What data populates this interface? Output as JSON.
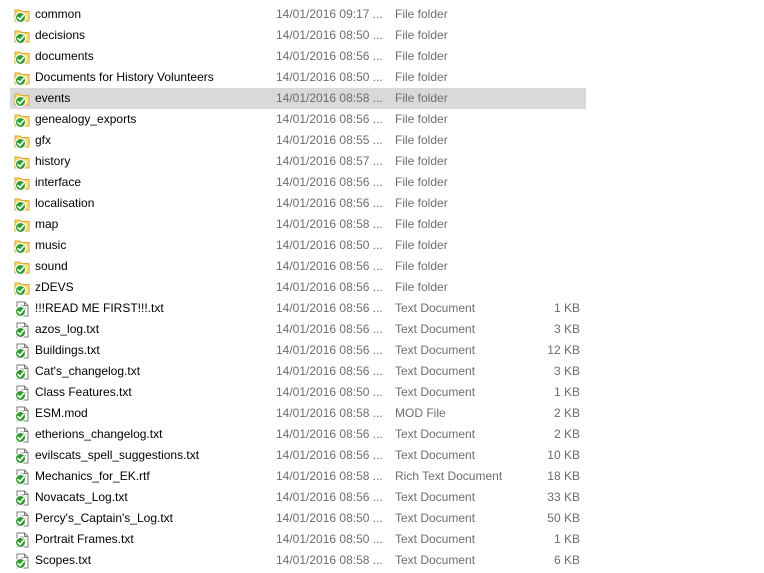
{
  "colors": {
    "folder": "#f7d565",
    "folder_edge": "#d9a93b",
    "check_green": "#2e9b2e",
    "doc_edge": "#7a7a7a",
    "selected_bg": "#d9d9d9"
  },
  "files": [
    {
      "name": "common",
      "date": "14/01/2016 09:17 ...",
      "type": "File folder",
      "size": "",
      "icon": "folder-synced-icon",
      "selected": false
    },
    {
      "name": "decisions",
      "date": "14/01/2016 08:50 ...",
      "type": "File folder",
      "size": "",
      "icon": "folder-synced-icon",
      "selected": false
    },
    {
      "name": "documents",
      "date": "14/01/2016 08:56 ...",
      "type": "File folder",
      "size": "",
      "icon": "folder-synced-icon",
      "selected": false
    },
    {
      "name": "Documents for History Volunteers",
      "date": "14/01/2016 08:50 ...",
      "type": "File folder",
      "size": "",
      "icon": "folder-synced-icon",
      "selected": false
    },
    {
      "name": "events",
      "date": "14/01/2016 08:58 ...",
      "type": "File folder",
      "size": "",
      "icon": "folder-synced-icon",
      "selected": true
    },
    {
      "name": "genealogy_exports",
      "date": "14/01/2016 08:56 ...",
      "type": "File folder",
      "size": "",
      "icon": "folder-synced-icon",
      "selected": false
    },
    {
      "name": "gfx",
      "date": "14/01/2016 08:55 ...",
      "type": "File folder",
      "size": "",
      "icon": "folder-synced-icon",
      "selected": false
    },
    {
      "name": "history",
      "date": "14/01/2016 08:57 ...",
      "type": "File folder",
      "size": "",
      "icon": "folder-synced-icon",
      "selected": false
    },
    {
      "name": "interface",
      "date": "14/01/2016 08:56 ...",
      "type": "File folder",
      "size": "",
      "icon": "folder-synced-icon",
      "selected": false
    },
    {
      "name": "localisation",
      "date": "14/01/2016 08:56 ...",
      "type": "File folder",
      "size": "",
      "icon": "folder-synced-icon",
      "selected": false
    },
    {
      "name": "map",
      "date": "14/01/2016 08:58 ...",
      "type": "File folder",
      "size": "",
      "icon": "folder-synced-icon",
      "selected": false
    },
    {
      "name": "music",
      "date": "14/01/2016 08:50 ...",
      "type": "File folder",
      "size": "",
      "icon": "folder-synced-icon",
      "selected": false
    },
    {
      "name": "sound",
      "date": "14/01/2016 08:56 ...",
      "type": "File folder",
      "size": "",
      "icon": "folder-synced-icon",
      "selected": false
    },
    {
      "name": "zDEVS",
      "date": "14/01/2016 08:56 ...",
      "type": "File folder",
      "size": "",
      "icon": "folder-synced-icon",
      "selected": false
    },
    {
      "name": "!!!READ ME FIRST!!!.txt",
      "date": "14/01/2016 08:56 ...",
      "type": "Text Document",
      "size": "1 KB",
      "icon": "document-synced-icon",
      "selected": false
    },
    {
      "name": "azos_log.txt",
      "date": "14/01/2016 08:56 ...",
      "type": "Text Document",
      "size": "3 KB",
      "icon": "document-synced-icon",
      "selected": false
    },
    {
      "name": "Buildings.txt",
      "date": "14/01/2016 08:56 ...",
      "type": "Text Document",
      "size": "12 KB",
      "icon": "document-synced-icon",
      "selected": false
    },
    {
      "name": "Cat's_changelog.txt",
      "date": "14/01/2016 08:56 ...",
      "type": "Text Document",
      "size": "3 KB",
      "icon": "document-synced-icon",
      "selected": false
    },
    {
      "name": "Class Features.txt",
      "date": "14/01/2016 08:50 ...",
      "type": "Text Document",
      "size": "1 KB",
      "icon": "document-synced-icon",
      "selected": false
    },
    {
      "name": "ESM.mod",
      "date": "14/01/2016 08:58 ...",
      "type": "MOD File",
      "size": "2 KB",
      "icon": "document-synced-icon",
      "selected": false
    },
    {
      "name": "etherions_changelog.txt",
      "date": "14/01/2016 08:56 ...",
      "type": "Text Document",
      "size": "2 KB",
      "icon": "document-synced-icon",
      "selected": false
    },
    {
      "name": "evilscats_spell_suggestions.txt",
      "date": "14/01/2016 08:56 ...",
      "type": "Text Document",
      "size": "10 KB",
      "icon": "document-synced-icon",
      "selected": false
    },
    {
      "name": "Mechanics_for_EK.rtf",
      "date": "14/01/2016 08:58 ...",
      "type": "Rich Text Document",
      "size": "18 KB",
      "icon": "document-synced-icon",
      "selected": false
    },
    {
      "name": "Novacats_Log.txt",
      "date": "14/01/2016 08:56 ...",
      "type": "Text Document",
      "size": "33 KB",
      "icon": "document-synced-icon",
      "selected": false
    },
    {
      "name": "Percy's_Captain's_Log.txt",
      "date": "14/01/2016 08:50 ...",
      "type": "Text Document",
      "size": "50 KB",
      "icon": "document-synced-icon",
      "selected": false
    },
    {
      "name": "Portrait Frames.txt",
      "date": "14/01/2016 08:50 ...",
      "type": "Text Document",
      "size": "1 KB",
      "icon": "document-synced-icon",
      "selected": false
    },
    {
      "name": "Scopes.txt",
      "date": "14/01/2016 08:58 ...",
      "type": "Text Document",
      "size": "6 KB",
      "icon": "document-synced-icon",
      "selected": false
    }
  ]
}
